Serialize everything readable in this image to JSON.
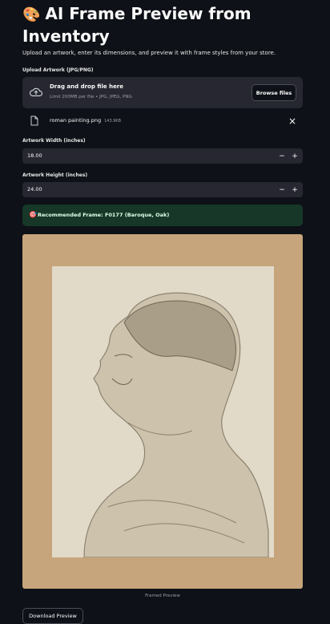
{
  "header": {
    "emoji": "🎨",
    "title": "AI Frame Preview from Inventory",
    "subtitle": "Upload an artwork, enter its dimensions, and preview it with frame styles from your store."
  },
  "upload": {
    "label": "Upload Artwork (JPG/PNG)",
    "drop_text": "Drag and drop file here",
    "limit_text": "Limit 200MB per file • JPG, JPEG, PNG",
    "browse_label": "Browse files",
    "file": {
      "name": "roman painting.png",
      "size": "143.9KB"
    }
  },
  "width_input": {
    "label": "Artwork Width (inches)",
    "value": "18.00",
    "minus": "−",
    "plus": "+"
  },
  "height_input": {
    "label": "Artwork Height (inches)",
    "value": "24.00",
    "minus": "−",
    "plus": "+"
  },
  "recommendation": {
    "icon": "🎯",
    "text": "Recommended Frame: F0177 (Baroque, Oak)"
  },
  "preview": {
    "caption": "Framed Preview"
  },
  "download": {
    "label": "Download Preview"
  },
  "colors": {
    "background": "#0e1117",
    "widget": "#262730",
    "success_bg": "#173828",
    "frame": "#c6a57c",
    "matte": "#e2dac9"
  }
}
